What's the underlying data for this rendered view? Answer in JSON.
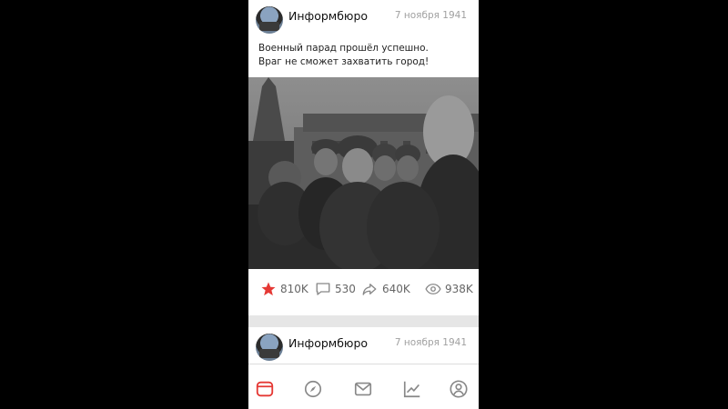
{
  "post": {
    "channel_name": "Информбюро",
    "date": "7 ноября 1941",
    "text_line1": "Военный парад прошёл успешно.",
    "text_line2": "Враг не сможет захватить город!",
    "likes": "810K",
    "comments": "530",
    "shares": "640K",
    "views": "938K"
  },
  "next_post": {
    "channel_name": "Информбюро",
    "date": "7 ноября 1941"
  },
  "tabbar": {
    "items": [
      "feed-icon",
      "compass-icon",
      "mail-icon",
      "trending-icon",
      "profile-icon"
    ],
    "active": "feed-icon",
    "accent": "#e53935"
  },
  "colors": {
    "like_active": "#e53935",
    "icon_gray": "#888888"
  }
}
